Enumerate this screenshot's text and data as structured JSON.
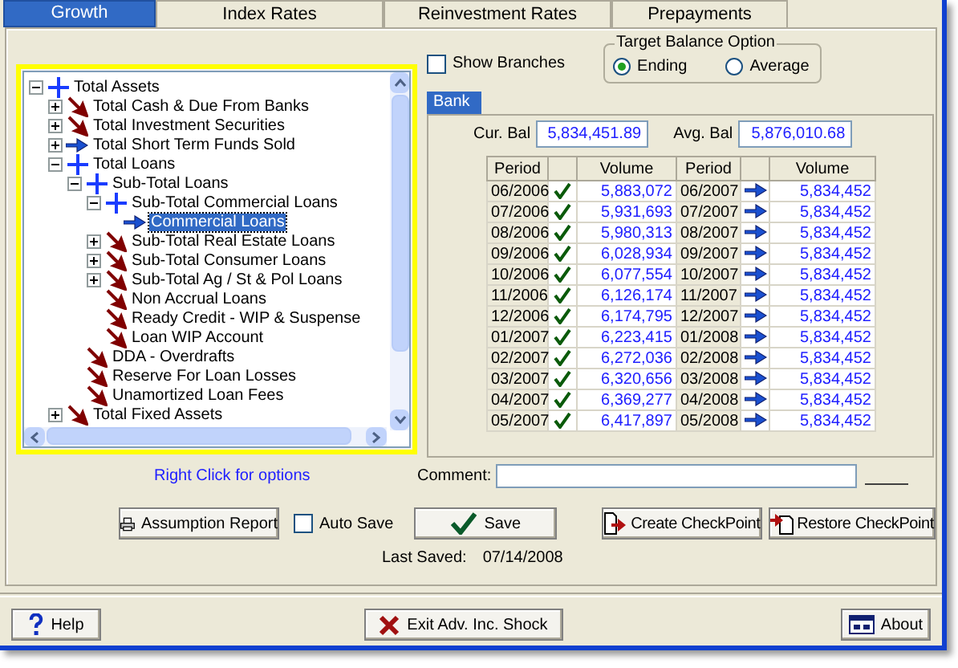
{
  "tabs": [
    {
      "label": "Growth",
      "selected": true
    },
    {
      "label": "Index Rates",
      "selected": false
    },
    {
      "label": "Reinvestment Rates",
      "selected": false
    },
    {
      "label": "Prepayments",
      "selected": false
    }
  ],
  "tree": [
    {
      "label": "Total Assets",
      "kind": "plus",
      "expanded": true,
      "selected": false,
      "children": [
        {
          "label": "Total Cash & Due From Banks",
          "kind": "down",
          "expanded": false,
          "selected": false
        },
        {
          "label": "Total Investment Securities",
          "kind": "down",
          "expanded": false,
          "selected": false
        },
        {
          "label": "Total Short Term Funds Sold",
          "kind": "flat",
          "expanded": false,
          "selected": false
        },
        {
          "label": "Total Loans",
          "kind": "plus",
          "expanded": true,
          "selected": false,
          "children": [
            {
              "label": "Sub-Total Loans",
              "kind": "plus",
              "expanded": true,
              "selected": false,
              "children": [
                {
                  "label": "Sub-Total Commercial Loans",
                  "kind": "plus",
                  "expanded": true,
                  "selected": false,
                  "children": [
                    {
                      "label": "Commercial Loans",
                      "kind": "flat",
                      "selected": true
                    }
                  ]
                },
                {
                  "label": "Sub-Total Real Estate Loans",
                  "kind": "down",
                  "expanded": false,
                  "selected": false
                },
                {
                  "label": "Sub-Total Consumer Loans",
                  "kind": "down",
                  "expanded": false,
                  "selected": false
                },
                {
                  "label": "Sub-Total Ag / St & Pol Loans",
                  "kind": "down",
                  "expanded": false,
                  "selected": false
                },
                {
                  "label": "Non Accrual Loans",
                  "kind": "down",
                  "selected": false
                },
                {
                  "label": "Ready Credit - WIP & Suspense",
                  "kind": "down",
                  "selected": false
                },
                {
                  "label": "Loan WIP Account",
                  "kind": "down",
                  "selected": false
                }
              ]
            },
            {
              "label": "DDA - Overdrafts",
              "kind": "down",
              "selected": false
            },
            {
              "label": "Reserve For Loan Losses",
              "kind": "down",
              "selected": false
            },
            {
              "label": "Unamortized Loan Fees",
              "kind": "down",
              "selected": false
            }
          ]
        },
        {
          "label": "Total Fixed Assets",
          "kind": "down",
          "expanded": false,
          "selected": false
        }
      ]
    }
  ],
  "tree_hint": "Right Click for options",
  "show_branches": {
    "label": "Show Branches",
    "checked": false
  },
  "target_balance": {
    "title": "Target Balance Option",
    "options": [
      {
        "label": "Ending",
        "selected": true
      },
      {
        "label": "Average",
        "selected": false
      }
    ]
  },
  "bank_tab": {
    "label": "Bank",
    "selected": true
  },
  "cur_bal": {
    "label": "Cur. Bal",
    "value": "5,834,451.89"
  },
  "avg_bal": {
    "label": "Avg. Bal",
    "value": "5,876,010.68"
  },
  "table": {
    "columns": [
      "Period",
      "",
      "Volume",
      "Period",
      "",
      "Volume"
    ],
    "rows": [
      {
        "period": "06/2006",
        "done": true,
        "volume": "5,883,072",
        "target_period": "06/2007",
        "target_volume": "5,834,452"
      },
      {
        "period": "07/2006",
        "done": true,
        "volume": "5,931,693",
        "target_period": "07/2007",
        "target_volume": "5,834,452"
      },
      {
        "period": "08/2006",
        "done": true,
        "volume": "5,980,313",
        "target_period": "08/2007",
        "target_volume": "5,834,452"
      },
      {
        "period": "09/2006",
        "done": true,
        "volume": "6,028,934",
        "target_period": "09/2007",
        "target_volume": "5,834,452"
      },
      {
        "period": "10/2006",
        "done": true,
        "volume": "6,077,554",
        "target_period": "10/2007",
        "target_volume": "5,834,452"
      },
      {
        "period": "11/2006",
        "done": true,
        "volume": "6,126,174",
        "target_period": "11/2007",
        "target_volume": "5,834,452"
      },
      {
        "period": "12/2006",
        "done": true,
        "volume": "6,174,795",
        "target_period": "12/2007",
        "target_volume": "5,834,452"
      },
      {
        "period": "01/2007",
        "done": true,
        "volume": "6,223,415",
        "target_period": "01/2008",
        "target_volume": "5,834,452"
      },
      {
        "period": "02/2007",
        "done": true,
        "volume": "6,272,036",
        "target_period": "02/2008",
        "target_volume": "5,834,452"
      },
      {
        "period": "03/2007",
        "done": true,
        "volume": "6,320,656",
        "target_period": "03/2008",
        "target_volume": "5,834,452"
      },
      {
        "period": "04/2007",
        "done": true,
        "volume": "6,369,277",
        "target_period": "04/2008",
        "target_volume": "5,834,452"
      },
      {
        "period": "05/2007",
        "done": true,
        "volume": "6,417,897",
        "target_period": "05/2008",
        "target_volume": "5,834,452"
      }
    ]
  },
  "comment": {
    "label": "Comment:"
  },
  "assumption_report": "Assumption Report",
  "auto_save": {
    "label": "Auto Save",
    "checked": false
  },
  "save": "Save",
  "create_checkpoint": "Create CheckPoint",
  "restore_checkpoint": "Restore CheckPoint",
  "last_saved": {
    "label": "Last Saved:",
    "value": "07/14/2008"
  },
  "footer": {
    "help": "Help",
    "exit": "Exit Adv. Inc. Shock",
    "about": "About"
  }
}
